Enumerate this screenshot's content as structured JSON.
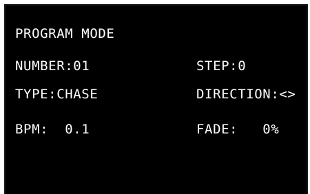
{
  "display": {
    "header": "PROGRAM MODE",
    "left": {
      "number": "NUMBER:01",
      "type": "TYPE:CHASE",
      "bpm": "BPM:  0.1"
    },
    "right": {
      "step": "STEP:0",
      "direction": "DIRECTION:<>",
      "fade": "FADE:   0%"
    }
  }
}
